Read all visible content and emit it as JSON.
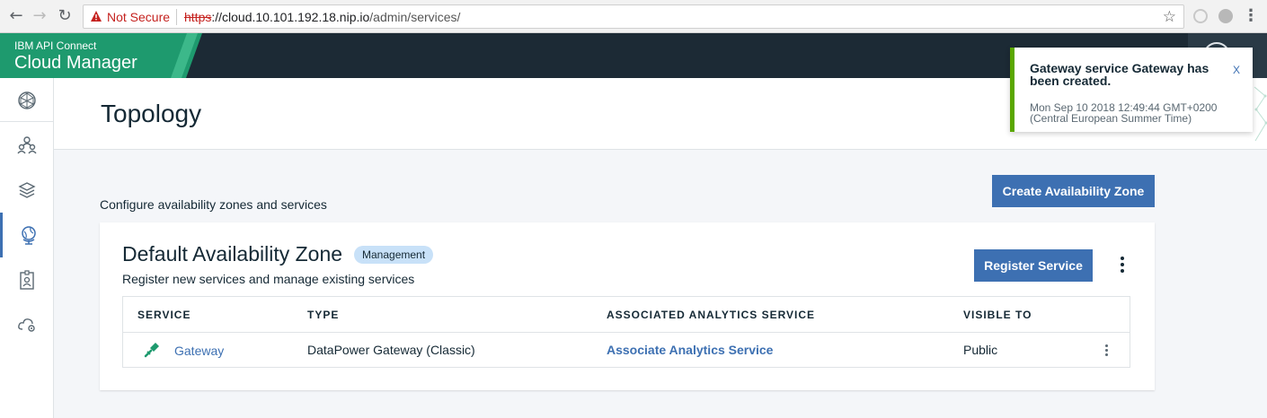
{
  "browser": {
    "not_secure": "Not Secure",
    "url_scheme": "https",
    "url_host": "://cloud.10.101.192.18.nip.io",
    "url_path": "/admin/services/"
  },
  "header": {
    "product_small": "IBM API Connect",
    "product_big": "Cloud Manager"
  },
  "sidebar": {
    "items": [
      {
        "icon": "globe-network-icon"
      },
      {
        "icon": "users-icon"
      },
      {
        "icon": "layers-icon"
      },
      {
        "icon": "topology-globe-icon",
        "active": true
      },
      {
        "icon": "member-badge-icon"
      },
      {
        "icon": "cloud-settings-icon"
      }
    ]
  },
  "page": {
    "title": "Topology",
    "subtitle": "Configure availability zones and services",
    "create_zone_label": "Create Availability Zone"
  },
  "zone": {
    "title": "Default Availability Zone",
    "badge": "Management",
    "description": "Register new services and manage existing services",
    "register_label": "Register Service",
    "columns": [
      "SERVICE",
      "TYPE",
      "ASSOCIATED ANALYTICS SERVICE",
      "VISIBLE TO"
    ],
    "rows": [
      {
        "service": "Gateway",
        "type": "DataPower Gateway (Classic)",
        "analytics": "Associate Analytics Service",
        "visible_to": "Public"
      }
    ]
  },
  "toast": {
    "title": "Gateway service Gateway has been created.",
    "close": "X",
    "time": "Mon Sep 10 2018 12:49:44 GMT+0200 (Central European Summer Time)"
  },
  "colors": {
    "primary": "#3d70b2",
    "brand": "#1e9a6e",
    "success": "#5aa700",
    "header": "#1c2a35"
  }
}
